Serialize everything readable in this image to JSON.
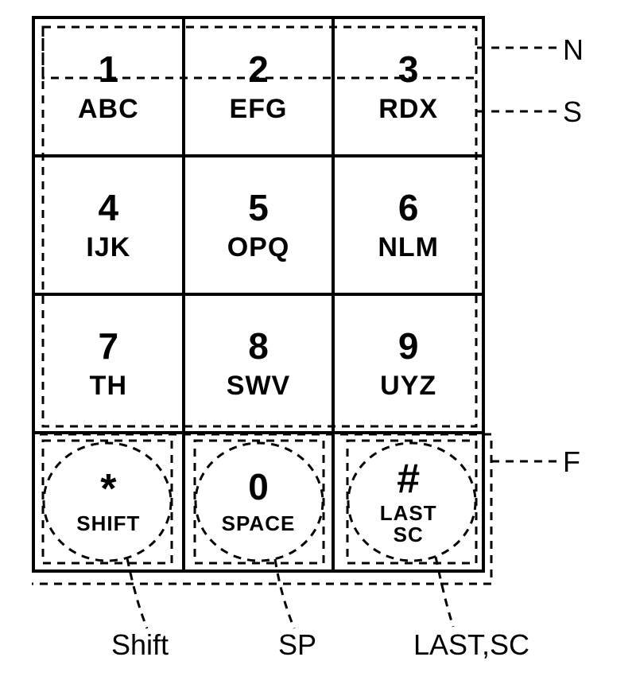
{
  "keys": [
    [
      {
        "num": "1",
        "letters": "ABC"
      },
      {
        "num": "2",
        "letters": "EFG"
      },
      {
        "num": "3",
        "letters": "RDX"
      }
    ],
    [
      {
        "num": "4",
        "letters": "IJK"
      },
      {
        "num": "5",
        "letters": "OPQ"
      },
      {
        "num": "6",
        "letters": "NLM"
      }
    ],
    [
      {
        "num": "7",
        "letters": "TH"
      },
      {
        "num": "8",
        "letters": "SWV"
      },
      {
        "num": "9",
        "letters": "UYZ"
      }
    ],
    [
      {
        "sym": "*",
        "fn": "SHIFT"
      },
      {
        "num": "0",
        "fn": "SPACE"
      },
      {
        "sym": "#",
        "fn": "LAST\nSC"
      }
    ]
  ],
  "labels": {
    "N": "N",
    "S": "S",
    "F": "F",
    "shift": "Shift",
    "sp": "SP",
    "lastsc": "LAST,SC"
  }
}
